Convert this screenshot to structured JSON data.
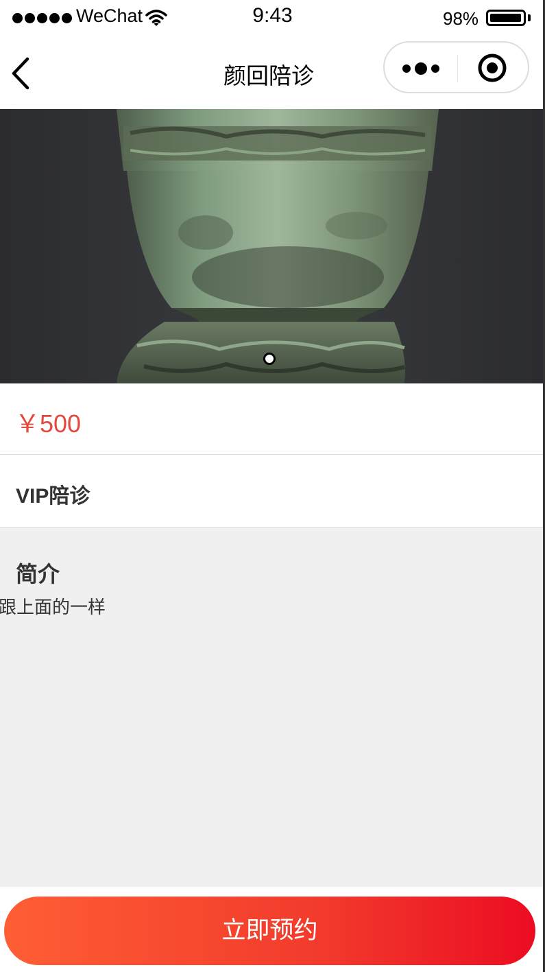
{
  "status_bar": {
    "carrier": "WeChat",
    "time": "9:43",
    "battery": "98%"
  },
  "nav": {
    "title": "颜回陪诊"
  },
  "banner": {
    "image": "bronze-vessel-photo",
    "slides": 1,
    "active_slide": 1
  },
  "product": {
    "price": "￥500",
    "name": "VIP陪诊"
  },
  "intro": {
    "heading": "简介",
    "body": "跟上面的一样"
  },
  "footer": {
    "button_label": "立即预约"
  },
  "colors": {
    "price": "#e5483d",
    "button_gradient_start": "#ff5e35",
    "button_gradient_end": "#ec0c22",
    "page_background": "#f0f0f0"
  }
}
